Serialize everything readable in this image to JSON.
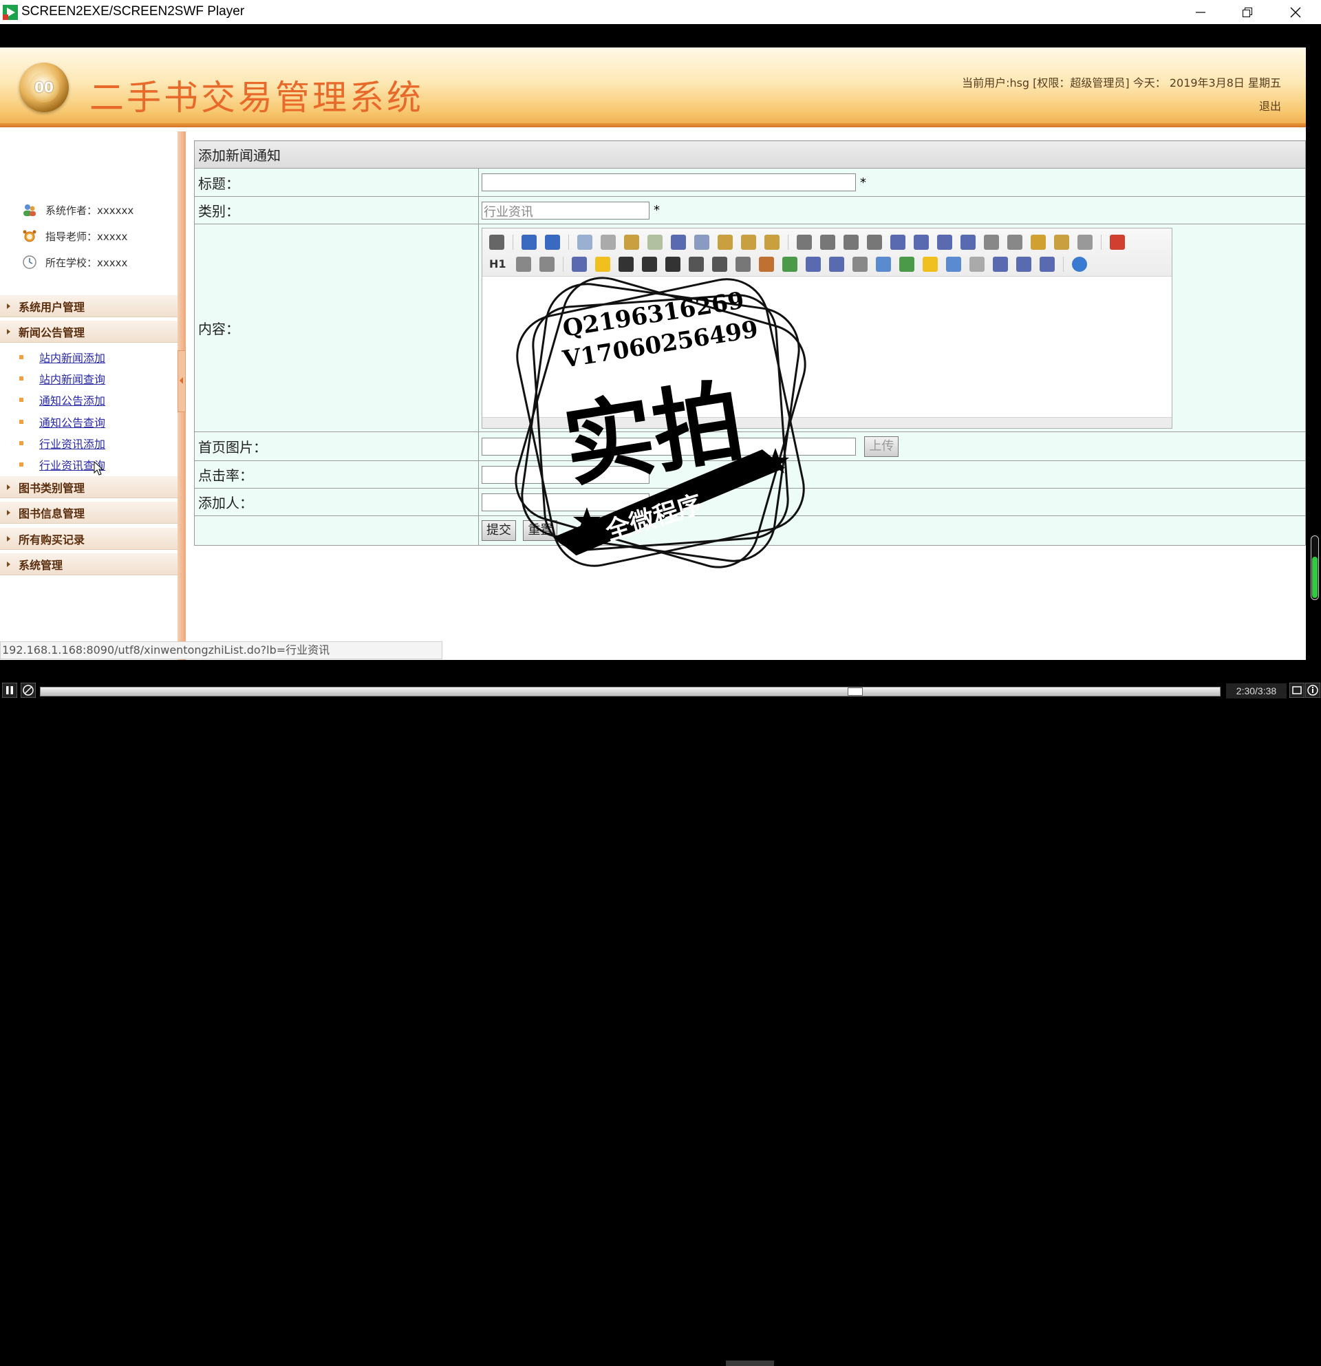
{
  "window": {
    "title": "SCREEN2EXE/SCREEN2SWF Player",
    "controls": [
      "minimize",
      "restore",
      "close"
    ]
  },
  "header": {
    "system_title": "二手书交易管理系统",
    "user_info": "当前用户:hsg [权限：超级管理员] 今天： 2019年3月8日 星期五",
    "logout": "退出"
  },
  "sidebar": {
    "info": [
      {
        "label": "系统作者：xxxxxx",
        "icon": "users-icon"
      },
      {
        "label": "指导老师：xxxxx",
        "icon": "alarm-clock-icon"
      },
      {
        "label": "所在学校：xxxxx",
        "icon": "clock-icon"
      }
    ],
    "menus": [
      {
        "label": "系统用户管理",
        "items": []
      },
      {
        "label": "新闻公告管理",
        "items": [
          "站内新闻添加",
          "站内新闻查询",
          "通知公告添加",
          "通知公告查询",
          "行业资讯添加",
          "行业资讯查询"
        ]
      },
      {
        "label": "图书类别管理",
        "items": []
      },
      {
        "label": "图书信息管理",
        "items": []
      },
      {
        "label": "所有购买记录",
        "items": []
      },
      {
        "label": "系统管理",
        "items": []
      }
    ]
  },
  "form": {
    "heading": "添加新闻通知",
    "title_label": "标题：",
    "title_value": "",
    "category_label": "类别：",
    "category_value": "行业资讯",
    "content_label": "内容：",
    "image_label": "首页图片：",
    "upload_button": "上传",
    "clicks_label": "点击率：",
    "adder_label": "添加人：",
    "required_mark": "*",
    "submit_button": "提交",
    "reset_button": "重置"
  },
  "editor": {
    "heading_dropdown": "H1"
  },
  "watermark": {
    "line1": "Q2196316269",
    "line2": "V17060256499",
    "big_text": "实拍",
    "banner_text": "全微程序"
  },
  "status_url": "192.168.1.168:8090/utf8/xinwentongzhiList.do?lb=行业资讯",
  "player": {
    "time": "2:30/3:38",
    "progress": 0.6905
  },
  "colors": {
    "title_orange": "#e86a2a",
    "link_blue": "#2929a6",
    "form_bg": "#eefcf8",
    "menu_text": "#5a2d0c"
  }
}
